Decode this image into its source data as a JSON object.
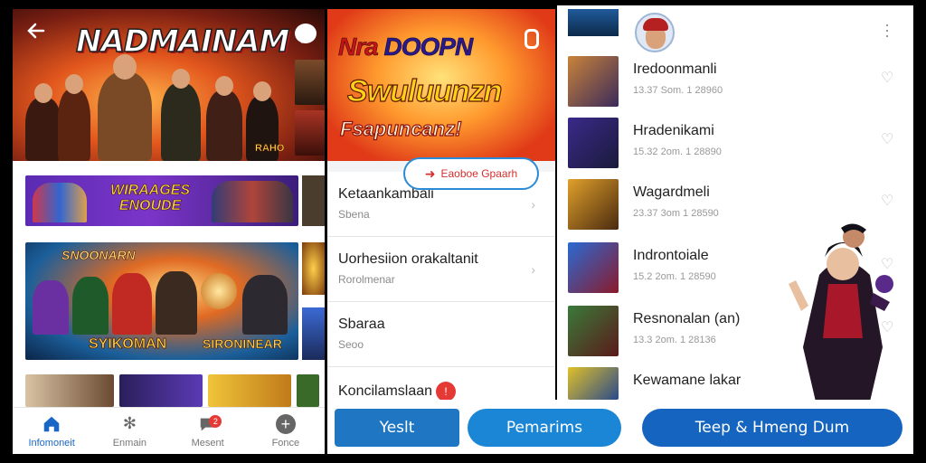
{
  "panel1": {
    "hero_title": "NADMAINAM",
    "badge": "RAHO",
    "banner1_text": "WIRAAGES ENOUDE",
    "banner2_top": "SNOONARN",
    "banner2_bottom": "SYIKOMAN",
    "banner2_bottom2": "SIRONINEAR",
    "nav": [
      {
        "label": "Infomoneit",
        "icon": "home-icon",
        "active": true
      },
      {
        "label": "Enmain",
        "icon": "gear-icon",
        "active": false
      },
      {
        "label": "Mesent",
        "icon": "chat-icon",
        "active": false,
        "badge": "2"
      },
      {
        "label": "Fonce",
        "icon": "plus-icon",
        "active": false
      }
    ]
  },
  "panel2": {
    "hero_line1a": "Nra",
    "hero_line1b": "DOOPN",
    "hero_line2": "Swuluunzn",
    "hero_line3": "Fsapuncanz!",
    "rows": [
      {
        "title": "Ketaankambali",
        "subtitle": "Sbena"
      },
      {
        "title": "Uorhesiion orakaltanit",
        "subtitle": "Rorolmenar"
      },
      {
        "title": "Sbaraa",
        "subtitle": "Seoo",
        "pill": "Eaoboe Gpaarh"
      },
      {
        "title": "Koncilamslaan",
        "badge": "!"
      }
    ]
  },
  "panel3": {
    "rows": [
      {
        "title": "Iredoonmanli",
        "subtitle": "13.37 Som. 1 28960"
      },
      {
        "title": "Hradenikami",
        "subtitle": "15.32 2om. 1 28890"
      },
      {
        "title": "Wagardmeli",
        "subtitle": "23.37 3om 1 28590"
      },
      {
        "title": "Indrontoiale",
        "subtitle": "15.2 2om. 1 28590"
      },
      {
        "title": "Resnonalan (an)",
        "subtitle": "13.3 2om. 1 28136"
      },
      {
        "title": "Kewamane lakar",
        "subtitle": ""
      }
    ]
  },
  "buttons": {
    "primary": "Yeslt",
    "secondary": "Pemarims",
    "tertiary": "Teep & Hmeng Dum"
  }
}
